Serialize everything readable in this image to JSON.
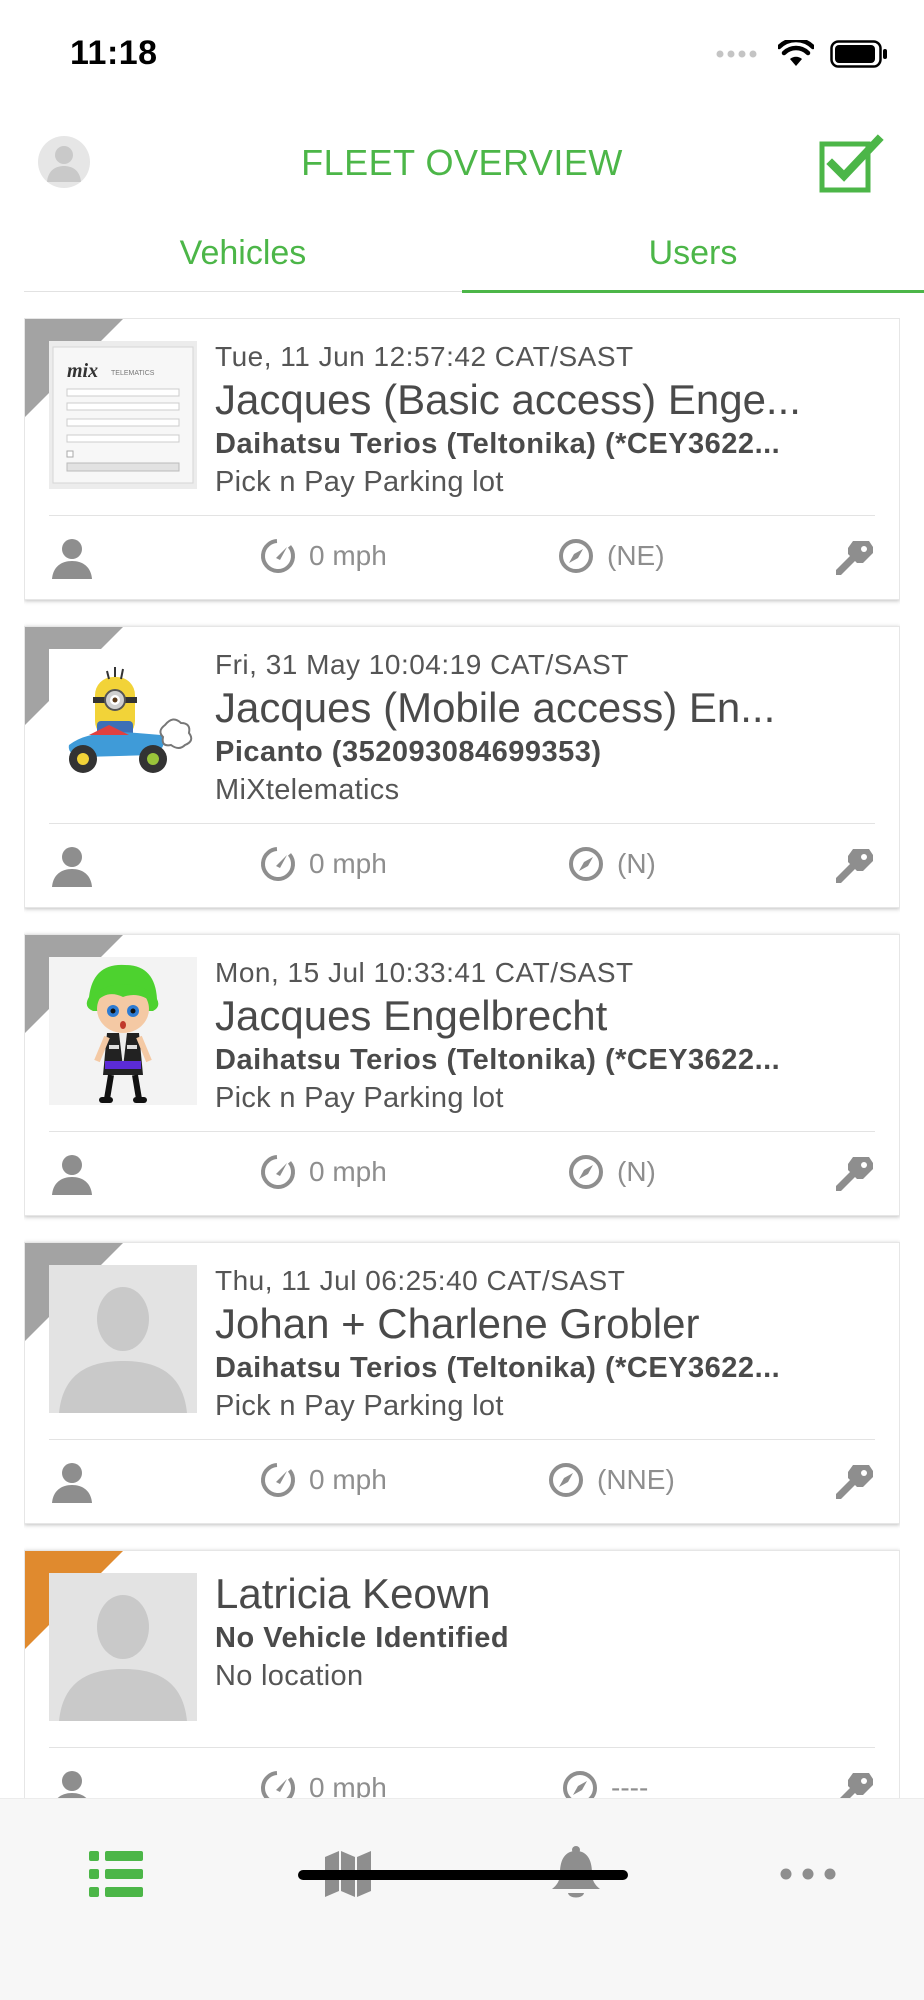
{
  "status_bar": {
    "time": "11:18"
  },
  "header": {
    "title": "FLEET OVERVIEW"
  },
  "tabs": [
    {
      "label": "Vehicles",
      "active": false
    },
    {
      "label": "Users",
      "active": true
    }
  ],
  "colors": {
    "accent": "#4cb648",
    "corner_gray": "#a3a3a3",
    "corner_orange": "#e08a2e"
  },
  "cards": [
    {
      "time": "Tue, 11 Jun 12:57:42 CAT/SAST",
      "name": "Jacques (Basic access) Enge...",
      "vehicle": "Daihatsu Terios (Teltonika) (*CEY3622...",
      "location": "Pick n Pay Parking lot",
      "speed": "0 mph",
      "heading": "(NE)",
      "avatar": "login-screenshot",
      "corner": "gray"
    },
    {
      "time": "Fri, 31 May 10:04:19 CAT/SAST",
      "name": "Jacques (Mobile access) En...",
      "vehicle": "Picanto (352093084699353)",
      "location": "MiXtelematics",
      "speed": "0 mph",
      "heading": "(N)",
      "avatar": "minion-kart",
      "corner": "gray"
    },
    {
      "time": "Mon, 15 Jul 10:33:41 CAT/SAST",
      "name": "Jacques Engelbrecht",
      "vehicle": "Daihatsu Terios (Teltonika) (*CEY3622...",
      "location": "Pick n Pay Parking lot",
      "speed": "0 mph",
      "heading": "(N)",
      "avatar": "green-hair-character",
      "corner": "gray"
    },
    {
      "time": "Thu, 11 Jul 06:25:40 CAT/SAST",
      "name": "Johan + Charlene Grobler",
      "vehicle": "Daihatsu Terios (Teltonika) (*CEY3622...",
      "location": "Pick n Pay Parking lot",
      "speed": "0 mph",
      "heading": "(NNE)",
      "avatar": "placeholder-person",
      "corner": "gray"
    },
    {
      "time": "",
      "name": "Latricia Keown",
      "vehicle": "No Vehicle Identified",
      "location": "No location",
      "speed": "0 mph",
      "heading": "----",
      "avatar": "placeholder-person",
      "corner": "orange"
    }
  ],
  "bottom_nav": [
    {
      "icon": "list-icon",
      "active": true
    },
    {
      "icon": "map-icon",
      "active": false
    },
    {
      "icon": "bell-icon",
      "active": false
    },
    {
      "icon": "more-icon",
      "active": false
    }
  ]
}
